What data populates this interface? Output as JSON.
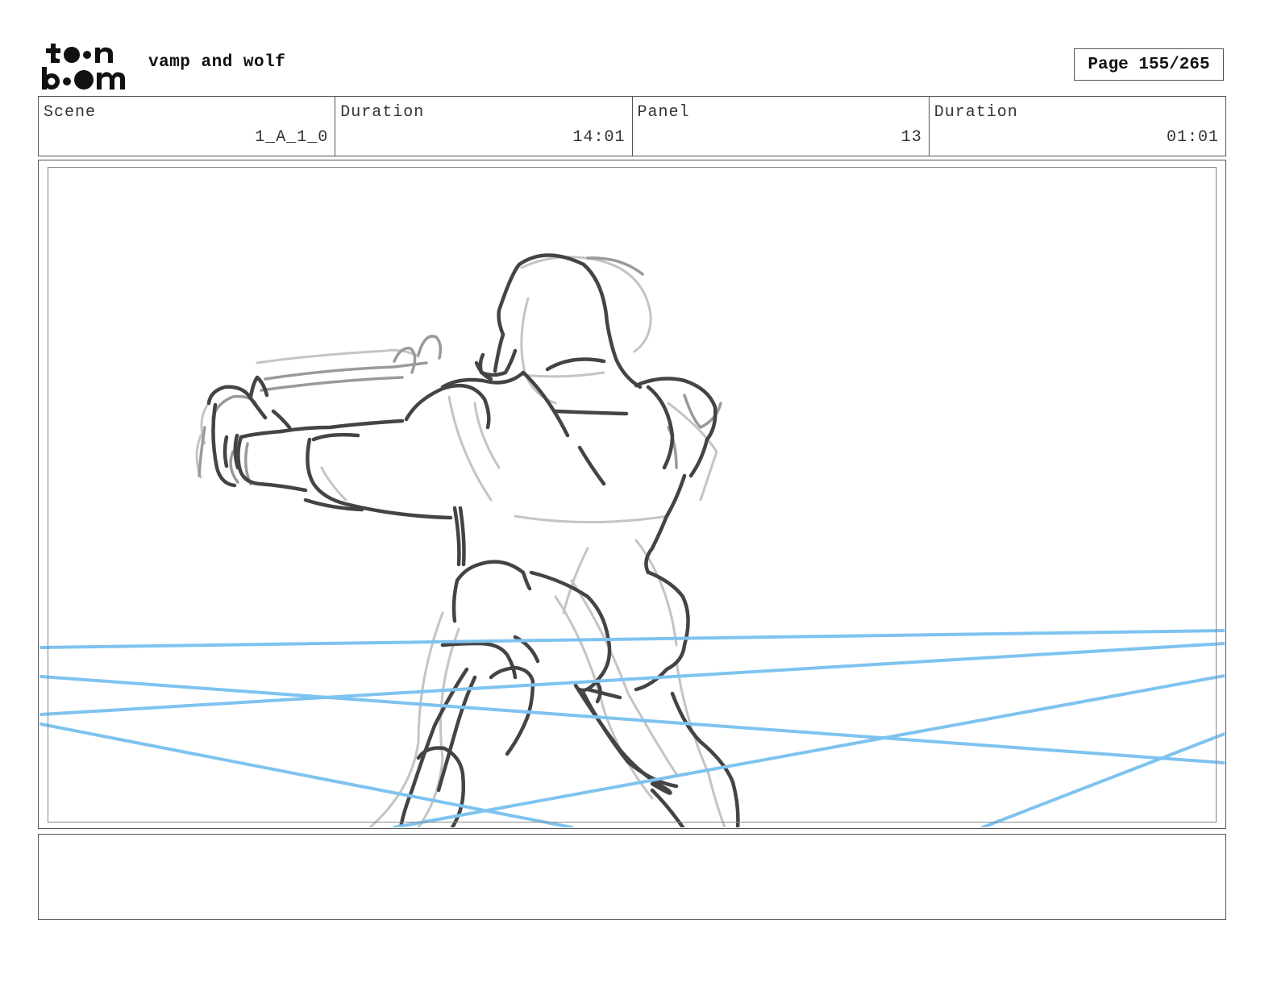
{
  "header": {
    "logo": "toon boom",
    "project_title": "vamp and wolf",
    "page_label": "Page 155/265"
  },
  "info": {
    "scene_label": "Scene",
    "scene_value": "1_A_1_0",
    "scene_duration_label": "Duration",
    "scene_duration_value": "14:01",
    "panel_label": "Panel",
    "panel_value": "13",
    "panel_duration_label": "Duration",
    "panel_duration_value": "01:01"
  },
  "panel": {
    "artwork": "rough-sketch-figure-with-blue-rope-lines",
    "colors": {
      "sketch_dark": "#333333",
      "sketch_light": "#bbbbbb",
      "guide_lines": "#7ec3ef"
    }
  },
  "notes": {
    "text": ""
  }
}
